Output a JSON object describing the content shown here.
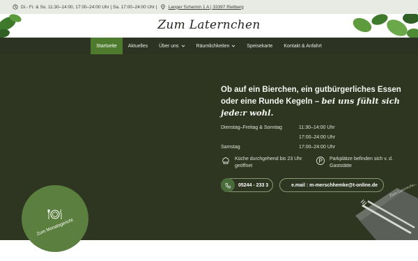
{
  "topbar": {
    "hours": "Di.- Fr. & So. 11:30–14:00, 17:00–24:00 Uhr | Sa. 17:00–24:00 Uhr |",
    "address": "Langer Schemm 1 A | 33397 Rietberg"
  },
  "header": {
    "logo": "Zum Laternchen"
  },
  "nav": {
    "items": [
      {
        "label": "Startseite"
      },
      {
        "label": "Aktuelles"
      },
      {
        "label": "Über uns"
      },
      {
        "label": "Räumlichkeiten"
      },
      {
        "label": "Speisekarte"
      },
      {
        "label": "Kontakt & Anfahrt"
      }
    ]
  },
  "hero": {
    "headline_plain": "Ob auf ein Bierchen, ein gutbürgerliches Essen oder eine Runde Kegeln –",
    "headline_script": "bei uns fühlt sich jede:r wohl.",
    "hours": [
      {
        "day": "Dienstag–Freitag & Sonntag",
        "time": "11:30–14:00 Uhr"
      },
      {
        "day": "",
        "time": "17:00–24:00 Uhr"
      },
      {
        "day": "Samstag",
        "time": "17:00–24:00 Uhr"
      }
    ],
    "kitchen": "Küche durchgehend bis 23 Uhr geöffnet",
    "parking": "Parkplätze befinden sich v. d. Gaststätte",
    "phone": "05244 - 233 3",
    "email": "e.mail : m-merschhemke@t-online.de",
    "napkin_text": "Zum Laternchen"
  },
  "badge": {
    "label": "Zum Monatsgericht"
  },
  "colors": {
    "dark_green": "#2e3621",
    "accent_green": "#4d7a2d",
    "nav_bg": "#2c3322"
  }
}
